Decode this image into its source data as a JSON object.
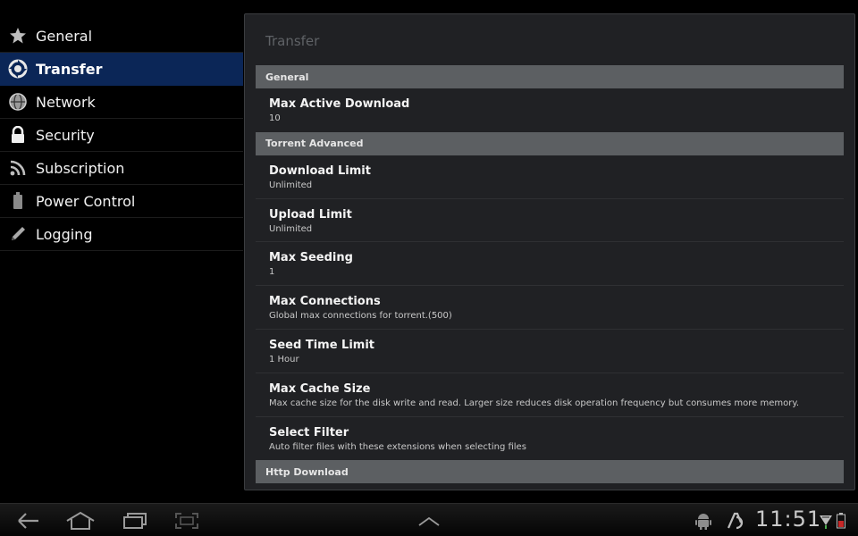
{
  "sidebar": {
    "items": [
      {
        "label": "General",
        "icon": "star-icon",
        "active": false
      },
      {
        "label": "Transfer",
        "icon": "transfer-icon",
        "active": true
      },
      {
        "label": "Network",
        "icon": "globe-icon",
        "active": false
      },
      {
        "label": "Security",
        "icon": "lock-icon",
        "active": false
      },
      {
        "label": "Subscription",
        "icon": "rss-icon",
        "active": false
      },
      {
        "label": "Power Control",
        "icon": "battery-icon",
        "active": false
      },
      {
        "label": "Logging",
        "icon": "pencil-icon",
        "active": false
      }
    ]
  },
  "panel": {
    "title": "Transfer",
    "categories": {
      "general": "General",
      "torrent_advanced": "Torrent Advanced",
      "http_download": "Http Download"
    },
    "general_items": [
      {
        "title": "Max Active Download",
        "summary": "10"
      }
    ],
    "torrent_items": [
      {
        "title": "Download Limit",
        "summary": "Unlimited"
      },
      {
        "title": "Upload Limit",
        "summary": "Unlimited"
      },
      {
        "title": "Max Seeding",
        "summary": "1"
      },
      {
        "title": "Max Connections",
        "summary": "Global max connections for torrent.(500)"
      },
      {
        "title": "Seed Time Limit",
        "summary": "1 Hour"
      },
      {
        "title": "Max Cache Size",
        "summary": "Max cache size for the disk write and read. Larger size reduces disk operation frequency but consumes more memory."
      },
      {
        "title": "Select Filter",
        "summary": "Auto filter files with these extensions when selecting files"
      }
    ]
  },
  "system_bar": {
    "clock": "11:51",
    "icons": [
      "back-icon",
      "home-icon",
      "recent-apps-icon",
      "screenshot-icon",
      "chevron-up-icon",
      "android-icon",
      "app-notification-icon",
      "wifi-icon",
      "battery-icon"
    ]
  },
  "colors": {
    "active_bg": "#0b2657",
    "category_bg": "#5c5f62",
    "panel_bg": "#202124"
  }
}
